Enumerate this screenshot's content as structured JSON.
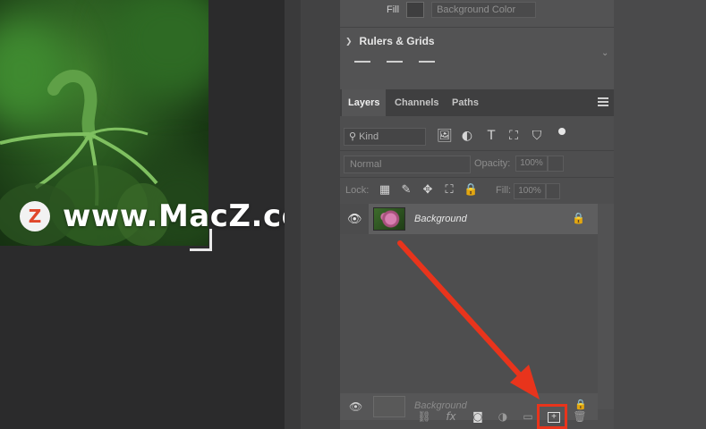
{
  "watermark": {
    "logo_letter": "Z",
    "text": "www.MacZ.com"
  },
  "properties": {
    "fill_label": "Fill",
    "fill_select": "Background Color",
    "rulers_header": "Rulers & Grids",
    "rulers_chevron": "❯",
    "scroll_indicator": "⌄"
  },
  "layers_panel": {
    "tabs": [
      {
        "label": "Layers",
        "active": true
      },
      {
        "label": "Channels",
        "active": false
      },
      {
        "label": "Paths",
        "active": false
      }
    ],
    "filter": {
      "placeholder": "Kind",
      "search_glyph": "⚲"
    },
    "filter_icons": [
      "🖼",
      "◐",
      "T",
      "⛶",
      "⛉"
    ],
    "blend_mode": "Normal",
    "opacity_label": "Opacity:",
    "opacity_value": "100%",
    "lock_label": "Lock:",
    "lock_icons": [
      "▦",
      "✎",
      "✥",
      "⛶",
      "🔒"
    ],
    "fill_label": "Fill:",
    "fill_value": "100%",
    "layers": [
      {
        "name": "Background",
        "visible": true,
        "locked": true
      }
    ],
    "ghost_layer": {
      "name": "Background"
    },
    "bottom_icons": [
      "⛓",
      "fx",
      "◙",
      "◑",
      "▭",
      "⊞",
      "🗑"
    ]
  },
  "annotation": {
    "color": "#e8341c"
  }
}
